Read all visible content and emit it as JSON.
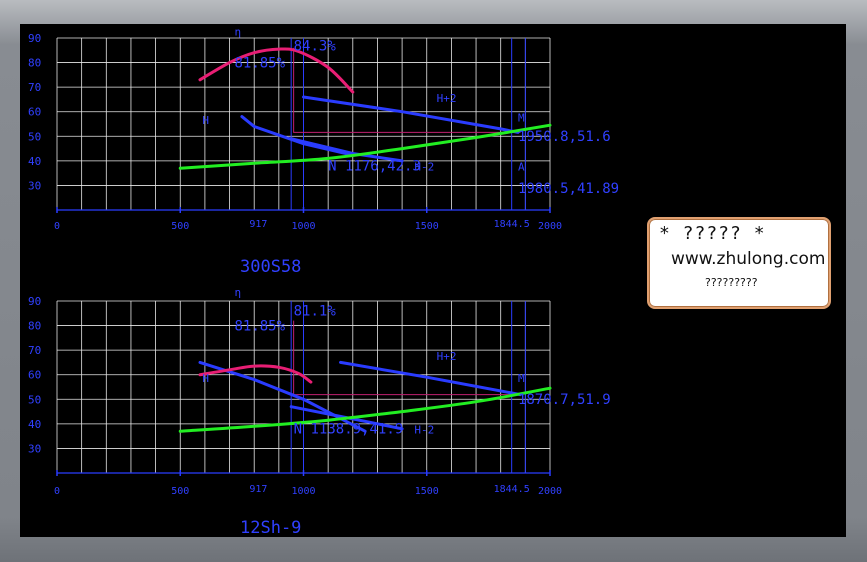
{
  "chart_data": [
    {
      "type": "line",
      "title": "300S58",
      "xlim": [
        0,
        2000
      ],
      "ylim": [
        20,
        90
      ],
      "x_ticks": [
        0,
        500,
        1000,
        1500,
        2000
      ],
      "y_ticks": [
        30,
        40,
        50,
        60,
        70,
        80,
        90
      ],
      "extra_x_labels": [
        {
          "x": 817,
          "text": "917"
        },
        {
          "x": 1844.5,
          "text": "1844.5"
        }
      ],
      "grid": true,
      "series": [
        {
          "name": "H",
          "color": "#2a3cff",
          "x": [
            750,
            800,
            1000,
            1200
          ],
          "y": [
            58,
            54,
            47,
            42.3
          ]
        },
        {
          "name": "H+2",
          "color": "#2a3cff",
          "x": [
            1000,
            1400,
            1800,
            1870
          ],
          "y": [
            66,
            60,
            53,
            51.6
          ]
        },
        {
          "name": "H-2",
          "color": "#2a3cff",
          "x": [
            950,
            1200,
            1400
          ],
          "y": [
            49,
            43,
            40
          ]
        },
        {
          "name": "η",
          "color": "#e81e74",
          "x": [
            580,
            700,
            800,
            900,
            980,
            1100,
            1200
          ],
          "y": [
            73,
            80,
            84,
            85.5,
            84.5,
            78,
            68
          ]
        },
        {
          "name": "",
          "color": "#22ee22",
          "x": [
            500,
            800,
            1100,
            1400,
            1700,
            2000
          ],
          "y": [
            37,
            39,
            41,
            45,
            49.5,
            54.5
          ]
        }
      ],
      "annotations": [
        {
          "text": "η",
          "x": 720,
          "y": 91
        },
        {
          "text": "84.3%",
          "x": 960,
          "y": 85
        },
        {
          "text": "81.85%",
          "x": 720,
          "y": 78
        },
        {
          "text": "H+2",
          "x": 1540,
          "y": 64
        },
        {
          "text": "H",
          "x": 590,
          "y": 55
        },
        {
          "text": "M",
          "x": 1870,
          "y": 56
        },
        {
          "text": "1950.8,51.6",
          "x": 1870,
          "y": 48
        },
        {
          "text": "N 1176,42.3",
          "x": 1100,
          "y": 36
        },
        {
          "text": "H-2",
          "x": 1450,
          "y": 36
        },
        {
          "text": "A",
          "x": 1870,
          "y": 36
        },
        {
          "text": "1980.5,41.89",
          "x": 1870,
          "y": 27
        }
      ]
    },
    {
      "type": "line",
      "title": "12Sh-9",
      "xlim": [
        0,
        2000
      ],
      "ylim": [
        20,
        90
      ],
      "x_ticks": [
        0,
        500,
        1000,
        1500,
        2000
      ],
      "y_ticks": [
        30,
        40,
        50,
        60,
        70,
        80,
        90
      ],
      "extra_x_labels": [
        {
          "x": 817,
          "text": "917"
        },
        {
          "x": 1844.5,
          "text": "1844.5"
        }
      ],
      "grid": true,
      "series": [
        {
          "name": "H",
          "color": "#2a3cff",
          "x": [
            580,
            800,
            1000,
            1250
          ],
          "y": [
            65,
            58,
            50,
            37
          ]
        },
        {
          "name": "H+2",
          "color": "#2a3cff",
          "x": [
            1150,
            1500,
            1880
          ],
          "y": [
            65,
            59,
            51.9
          ]
        },
        {
          "name": "H-2",
          "color": "#2a3cff",
          "x": [
            950,
            1200,
            1400
          ],
          "y": [
            47,
            42,
            38
          ]
        },
        {
          "name": "η",
          "color": "#e81e74",
          "x": [
            580,
            700,
            800,
            900,
            980,
            1030
          ],
          "y": [
            60,
            62,
            63.5,
            63,
            60.5,
            57
          ]
        },
        {
          "name": "",
          "color": "#22ee22",
          "x": [
            500,
            800,
            1100,
            1400,
            1700,
            2000
          ],
          "y": [
            37,
            39,
            41.5,
            45,
            49,
            54.5
          ]
        }
      ],
      "annotations": [
        {
          "text": "η",
          "x": 720,
          "y": 92
        },
        {
          "text": "81.1%",
          "x": 960,
          "y": 84
        },
        {
          "text": "81.85%",
          "x": 720,
          "y": 78
        },
        {
          "text": "H+2",
          "x": 1540,
          "y": 66
        },
        {
          "text": "H",
          "x": 590,
          "y": 57
        },
        {
          "text": "M",
          "x": 1870,
          "y": 57
        },
        {
          "text": "1870.7,51.9",
          "x": 1870,
          "y": 48
        },
        {
          "text": "N 1138.9,41.9",
          "x": 960,
          "y": 36
        },
        {
          "text": "H-2",
          "x": 1450,
          "y": 36
        }
      ]
    }
  ],
  "watermark": {
    "line1": "* ????? *",
    "line2": "www.zhulong.com",
    "line3": "?????????"
  }
}
